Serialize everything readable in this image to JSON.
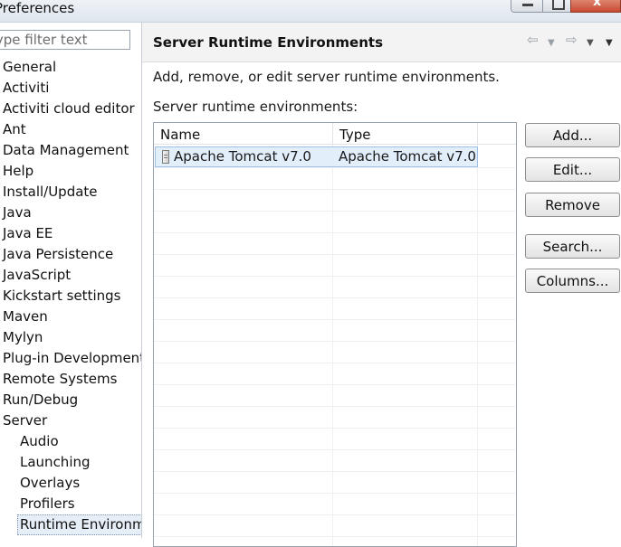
{
  "window": {
    "title": "Preferences",
    "close_glyph": "x"
  },
  "filter": {
    "placeholder": "type filter text"
  },
  "tree": {
    "items": [
      {
        "label": "General"
      },
      {
        "label": "Activiti"
      },
      {
        "label": "Activiti cloud editor"
      },
      {
        "label": "Ant"
      },
      {
        "label": "Data Management"
      },
      {
        "label": "Help"
      },
      {
        "label": "Install/Update"
      },
      {
        "label": "Java"
      },
      {
        "label": "Java EE"
      },
      {
        "label": "Java Persistence"
      },
      {
        "label": "JavaScript"
      },
      {
        "label": "Kickstart settings"
      },
      {
        "label": "Maven"
      },
      {
        "label": "Mylyn"
      },
      {
        "label": "Plug-in Development"
      },
      {
        "label": "Remote Systems"
      },
      {
        "label": "Run/Debug"
      },
      {
        "label": "Server"
      }
    ],
    "server_children": [
      {
        "label": "Audio"
      },
      {
        "label": "Launching"
      },
      {
        "label": "Overlays"
      },
      {
        "label": "Profilers"
      },
      {
        "label": "Runtime Environments"
      }
    ]
  },
  "page": {
    "title": "Server Runtime Environments",
    "description": "Add, remove, or edit server runtime environments.",
    "list_label": "Server runtime environments:",
    "nav": {
      "back_glyph": "⇦",
      "forward_glyph": "⇨",
      "dropdown_glyph": "▼"
    }
  },
  "table": {
    "columns": [
      "Name",
      "Type"
    ],
    "rows": [
      {
        "name": "Apache Tomcat v7.0",
        "type": "Apache Tomcat v7.0"
      }
    ]
  },
  "buttons": {
    "add": "Add...",
    "edit": "Edit...",
    "remove": "Remove",
    "search": "Search...",
    "columns": "Columns..."
  }
}
